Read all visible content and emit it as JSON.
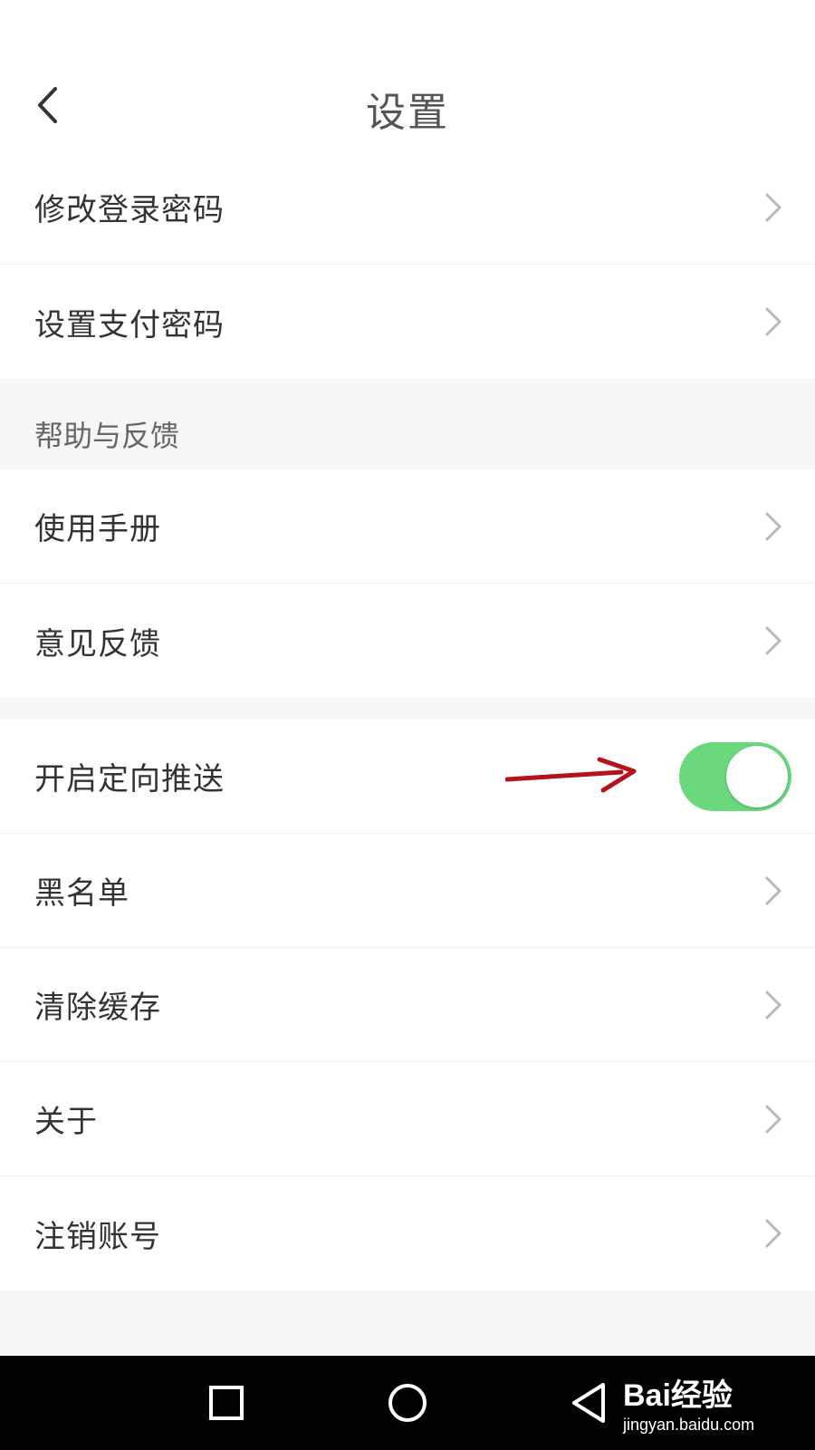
{
  "header": {
    "title": "设置",
    "back_icon": "chevron-left-icon"
  },
  "group1": {
    "items": [
      {
        "label": "修改登录密码"
      },
      {
        "label": "设置支付密码"
      }
    ]
  },
  "section_help": {
    "title": "帮助与反馈",
    "items": [
      {
        "label": "使用手册"
      },
      {
        "label": "意见反馈"
      }
    ]
  },
  "group3": {
    "push_toggle": {
      "label": "开启定向推送",
      "on": true,
      "color": "#6ad97e"
    },
    "items": [
      {
        "label": "黑名单"
      },
      {
        "label": "清除缓存"
      },
      {
        "label": "关于"
      },
      {
        "label": "注销账号"
      }
    ]
  },
  "annotation": {
    "arrow_color": "#b3141c"
  },
  "navbar": {
    "buttons": [
      "square-recents-icon",
      "circle-home-icon",
      "triangle-back-icon"
    ]
  },
  "watermark": {
    "main": "Bai经验",
    "sub": "jingyan.baidu.com"
  }
}
